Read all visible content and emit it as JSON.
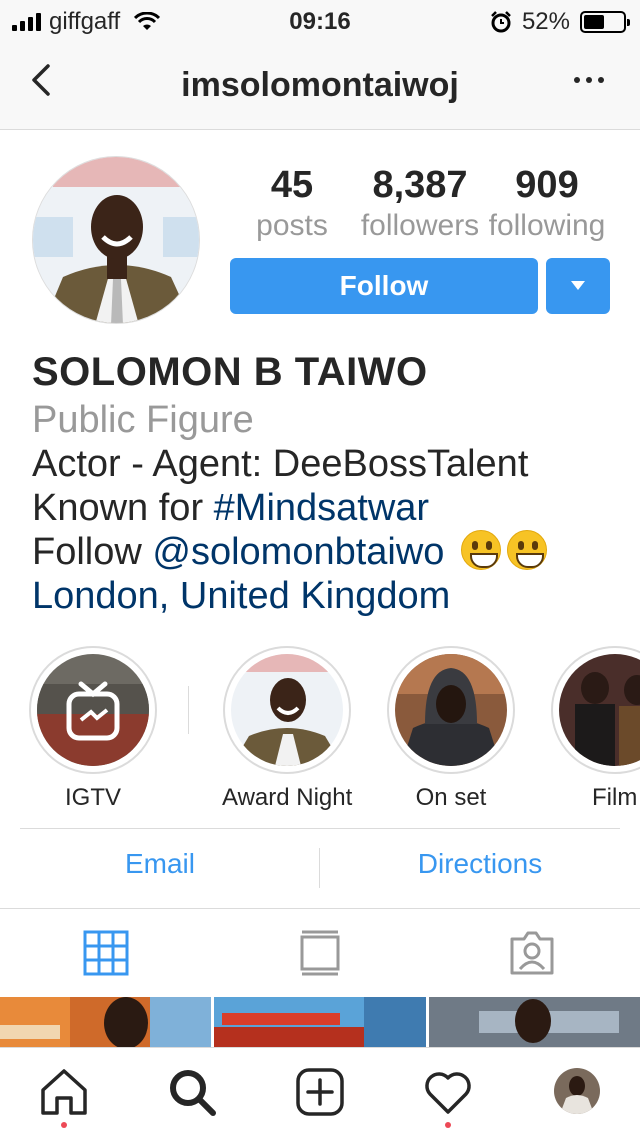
{
  "status_bar": {
    "carrier": "giffgaff",
    "time": "09:16",
    "battery": "52%",
    "battery_level": 0.52
  },
  "nav": {
    "username": "imsolomontaiwoj",
    "back_icon": "chevron-left-icon",
    "more_icon": "ellipsis-icon"
  },
  "stats": [
    {
      "value": "45",
      "label": "posts"
    },
    {
      "value": "8,387",
      "label": "followers"
    },
    {
      "value": "909",
      "label": "following"
    }
  ],
  "actions": {
    "follow_label": "Follow",
    "dropdown_icon": "caret-down-icon",
    "accent_color": "#3897f0"
  },
  "bio": {
    "name": "SOLOMON B TAIWO",
    "category": "Public Figure",
    "line1": "Actor - Agent: DeeBossTalent",
    "line2_prefix": "Known for ",
    "line2_tag": "#Mindsatwar",
    "line3_prefix": "Follow ",
    "line3_mention": "@solomonbtaiwo",
    "location": "London, United Kingdom",
    "link_color": "#003569"
  },
  "highlights": [
    {
      "label": "IGTV",
      "icon": "igtv-icon"
    },
    {
      "label": "Award Night"
    },
    {
      "label": "On set"
    },
    {
      "label": "Film"
    }
  ],
  "contact": {
    "email_label": "Email",
    "directions_label": "Directions"
  },
  "tabs": [
    {
      "icon": "grid-icon",
      "active": true
    },
    {
      "icon": "feed-icon",
      "active": false
    },
    {
      "icon": "tagged-icon",
      "active": false
    }
  ],
  "bottom_nav": [
    {
      "icon": "home-icon"
    },
    {
      "icon": "search-icon"
    },
    {
      "icon": "new-post-icon"
    },
    {
      "icon": "heart-icon"
    },
    {
      "icon": "profile-avatar"
    }
  ]
}
